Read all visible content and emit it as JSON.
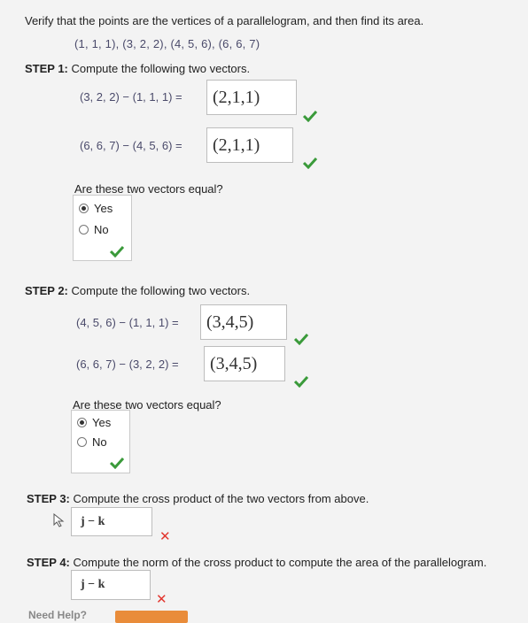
{
  "prompt": "Verify that the points are the vertices of a parallelogram, and then find its area.",
  "points": "(1, 1, 1), (3, 2, 2), (4, 5, 6), (6, 6, 7)",
  "step1": {
    "label": "STEP 1:",
    "text": " Compute the following two vectors.",
    "expr1": "(3, 2, 2) − (1, 1, 1) =",
    "ans1": "(2,1,1)",
    "expr2": "(6, 6, 7) − (4, 5, 6) =",
    "ans2": "(2,1,1)",
    "question": "Are these two vectors equal?",
    "yes": "Yes",
    "no": "No",
    "selected": "Yes"
  },
  "step2": {
    "label": "STEP 2:",
    "text": " Compute the following two vectors.",
    "expr1": "(4, 5, 6) − (1, 1, 1) =",
    "ans1": "(3,4,5)",
    "expr2": "(6, 6, 7) − (3, 2, 2) =",
    "ans2": "(3,4,5)",
    "question": "Are these two vectors equal?",
    "yes": "Yes",
    "no": "No",
    "selected": "Yes"
  },
  "step3": {
    "label": "STEP 3:",
    "text": " Compute the cross product of the two vectors from above.",
    "answer": "j − k"
  },
  "step4": {
    "label": "STEP 4:",
    "text": " Compute the norm of the cross product to compute the area of the parallelogram.",
    "answer": "j − k"
  },
  "help": {
    "label": "Need Help?"
  },
  "colors": {
    "check": "#3a9a3a",
    "cross": "#e2362f",
    "help_button": "#e98c3a"
  }
}
